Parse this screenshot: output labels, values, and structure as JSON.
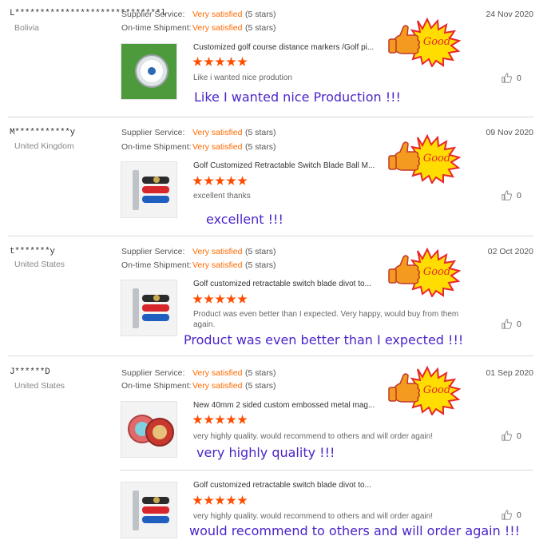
{
  "labels": {
    "supplier_service": "Supplier Service:",
    "ontime_shipment": "On-time Shipment:",
    "rating_word": "Very satisfied",
    "rating_stars": "(5 stars)",
    "good_badge": "Good"
  },
  "reviews": [
    {
      "buyer": "L*****************************l",
      "country": "Bolivia",
      "date": "24 Nov 2020",
      "product_title": "Customized golf course distance markers /Golf pi...",
      "stars": 5,
      "comment": "Like i wanted nice prodution",
      "likes": "0",
      "handwritten": "Like I wanted nice Production !!!"
    },
    {
      "buyer": "M***********y",
      "country": "United Kingdom",
      "date": "09 Nov 2020",
      "product_title": "Golf Customized Retractable Switch Blade Ball M...",
      "stars": 5,
      "comment": "excellent thanks",
      "likes": "0",
      "handwritten": "excellent !!!"
    },
    {
      "buyer": "t*******y",
      "country": "United States",
      "date": "02 Oct 2020",
      "product_title": "Golf customized retractable switch blade divot to...",
      "stars": 5,
      "comment": "Product was even better than I expected. Very happy, would buy from them again.",
      "likes": "0",
      "handwritten": "Product was even better than I expected !!!"
    },
    {
      "buyer": "J******D",
      "country": "United States",
      "date": "01 Sep 2020",
      "product_title": "New 40mm 2 sided custom embossed metal mag...",
      "stars": 5,
      "comment": "very highly quality. would recommend to others and will order again!",
      "likes": "0",
      "handwritten": "very highly quality !!!"
    },
    {
      "product_title": "Golf customized retractable switch blade divot to...",
      "stars": 5,
      "comment": "very highly quality. would recommend to others and will order again!",
      "likes": "0",
      "handwritten": "would recommend to others and will order again !!!"
    }
  ],
  "colors": {
    "accent_orange": "#ff6a00",
    "star_color": "#ff4d00",
    "handwriting_purple": "#4b24c8",
    "badge_yellow": "#ffdd00",
    "badge_red": "#e8262d"
  },
  "icons": [
    "thumbs-up-icon",
    "star-icon",
    "good-badge-icon"
  ]
}
